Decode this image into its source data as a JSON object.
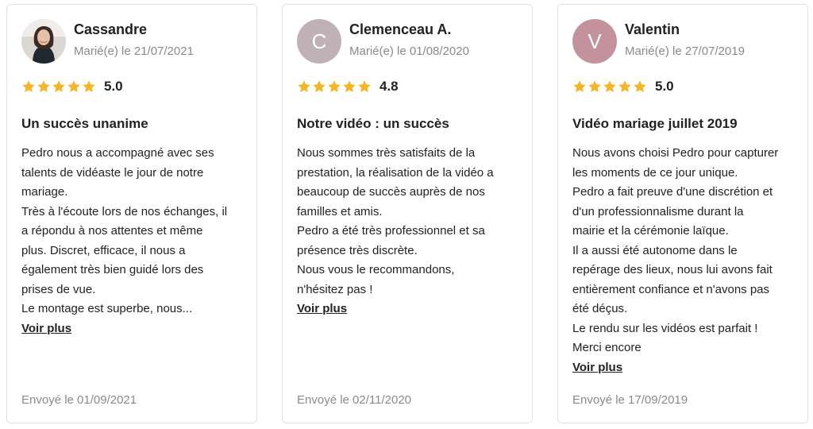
{
  "colors": {
    "star": "#f5b626",
    "muted": "#8a8a8a",
    "text": "#222222"
  },
  "reviews": [
    {
      "name": "Cassandre",
      "married": "Marié(e) le 21/07/2021",
      "avatar": {
        "type": "photo",
        "icon": "user-photo-icon"
      },
      "rating": "5.0",
      "stars": 5,
      "title": "Un succès unanime",
      "lines": [
        "Pedro nous a accompagné avec ses",
        "talents de vidéaste le jour de notre",
        "mariage.",
        "Très à l'écoute lors de nos échanges, il",
        "a répondu à nos attentes et même",
        "plus. Discret, efficace, il nous a",
        "également très bien guidé lors des",
        "prises de vue.",
        "Le montage est superbe, nous..."
      ],
      "more": "Voir plus",
      "sent": "Envoyé le 01/09/2021"
    },
    {
      "name": "Clemenceau A.",
      "married": "Marié(e) le 01/08/2020",
      "avatar": {
        "type": "initial",
        "letter": "C",
        "color": "#c0b1b6"
      },
      "rating": "4.8",
      "stars": 5,
      "title": "Notre vidéo : un succès",
      "lines": [
        "Nous sommes très satisfaits de la",
        "prestation, la réalisation de la vidéo a",
        "beaucoup de succès auprès de nos",
        "familles et amis.",
        "Pedro a été très professionnel et sa",
        "présence très discrète.",
        "Nous vous le recommandons,",
        "n'hésitez pas !"
      ],
      "more": "Voir plus",
      "sent": "Envoyé le 02/11/2020"
    },
    {
      "name": "Valentin",
      "married": "Marié(e) le 27/07/2019",
      "avatar": {
        "type": "initial",
        "letter": "V",
        "color": "#c3929c"
      },
      "rating": "5.0",
      "stars": 5,
      "title": "Vidéo mariage juillet 2019",
      "lines": [
        "Nous avons choisi Pedro pour capturer",
        "les moments de ce jour unique.",
        "Pedro a fait preuve d'une discrétion et",
        "d'un professionnalisme durant la",
        "mairie et la cérémonie laïque.",
        "Il a aussi été autonome dans le",
        "repérage des lieux, nous lui avons fait",
        "entièrement confiance et n'avons pas",
        "été déçus.",
        "Le rendu sur les vidéos est parfait !",
        "Merci encore"
      ],
      "more": "Voir plus",
      "sent": "Envoyé le 17/09/2019"
    }
  ]
}
